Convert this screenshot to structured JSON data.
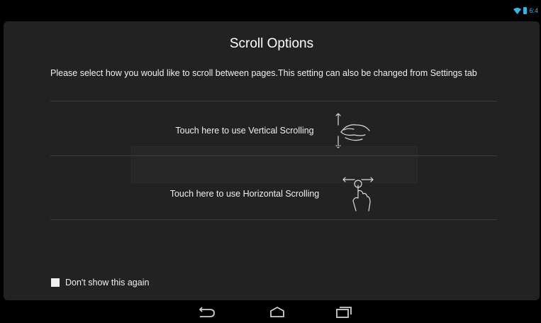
{
  "status_bar": {
    "time": "6:4"
  },
  "dialog": {
    "title": "Scroll Options",
    "message": "Please select how you would like to scroll between pages.This setting can also be changed from Settings tab",
    "options": [
      {
        "label": "Touch here to use Vertical Scrolling",
        "icon": "vertical-swipe-hand-icon"
      },
      {
        "label": "Touch here to use Horizontal Scrolling",
        "icon": "horizontal-swipe-hand-icon"
      }
    ],
    "checkbox": {
      "label": "Don't show this again",
      "checked": false
    }
  },
  "nav_bar": {
    "icons": [
      "back-icon",
      "home-icon",
      "recent-apps-icon"
    ]
  },
  "colors": {
    "dialog_bg": "#222222",
    "accent": "#33b5e5"
  }
}
